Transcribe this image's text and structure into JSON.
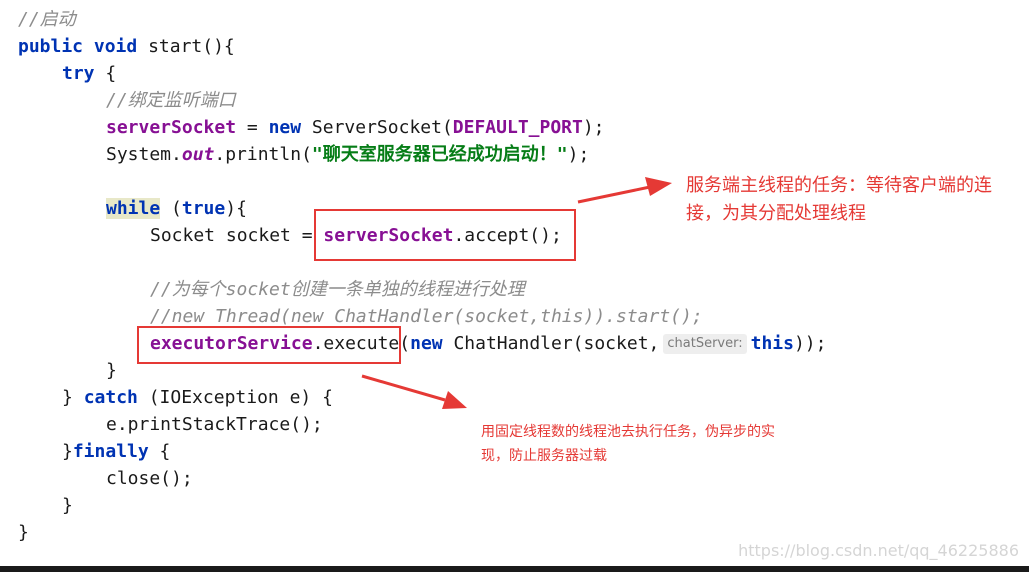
{
  "code": {
    "comment_start": "//启动",
    "method_sig": [
      "public",
      "void",
      "start(){"
    ],
    "try_kw": "try",
    "try_brace": "{",
    "comment_bind": "//绑定监听端口",
    "server_socket_field": "serverSocket",
    "assign": " = ",
    "new_kw": "new",
    "server_socket_ctor": " ServerSocket(",
    "default_port": "DEFAULT_PORT",
    "close_paren_semi": ");",
    "system": "System.",
    "out": "out",
    "println": ".println(",
    "success_string": "\"聊天室服务器已经成功启动！\"",
    "while_kw": "while",
    "while_rest": " (",
    "true_kw": "true",
    "while_end": "){",
    "socket_decl": "Socket socket = ",
    "accept_field": "serverSocket",
    "accept_call": ".accept();",
    "comment_each": "//为每个socket创建一条单独的线程进行处理",
    "comment_thread": "//new Thread(new ChatHandler(socket,this)).start();",
    "executor_field": "executorService",
    "execute_call": ".execute(",
    "chat_handler": " ChatHandler(socket,",
    "hint_label": "chatServer:",
    "this_kw": "this",
    "end_execute": "));",
    "close_brace": "}",
    "catch_close": "} ",
    "catch_kw": "catch",
    "catch_rest": " (IOException e) {",
    "print_stack": "e.printStackTrace();",
    "finally_open": "}",
    "finally_kw": "finally",
    "finally_rest": " {",
    "close_call": "close();",
    "final_brace": "}"
  },
  "annotations": {
    "server_task": "服务端主线程的任务：等待客户端的连接，为其分配处理线程",
    "thread_pool": "用固定线程数的线程池去执行任务，伪异步的实现，防止服务器过载"
  },
  "watermark": "https://blog.csdn.net/qq_46225886",
  "colors": {
    "keyword": "#0033b3",
    "field": "#871094",
    "string": "#067d17",
    "comment": "#8c8c8c",
    "annotation_red": "#e53935"
  }
}
